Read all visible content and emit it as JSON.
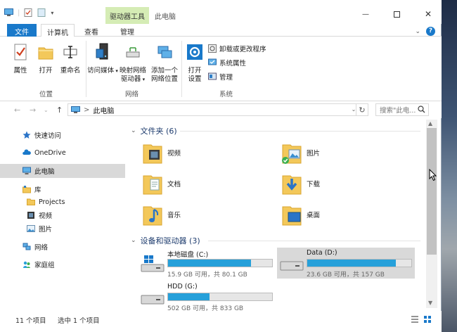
{
  "window": {
    "title": "此电脑",
    "context_tab": "驱动器工具",
    "tabs": {
      "file": "文件",
      "computer": "计算机",
      "view": "查看",
      "manage": "管理"
    }
  },
  "ribbon": {
    "location": {
      "label": "位置",
      "properties": "属性",
      "open": "打开",
      "rename": "重命名"
    },
    "network": {
      "label": "网络",
      "access_media": "访问媒体",
      "map_drive_1": "映射网络",
      "map_drive_2": "驱动器",
      "add_location_1": "添加一个",
      "add_location_2": "网络位置"
    },
    "system": {
      "label": "系统",
      "open_settings_1": "打开",
      "open_settings_2": "设置",
      "uninstall": "卸载或更改程序",
      "sys_properties": "系统属性",
      "manage": "管理"
    }
  },
  "address": {
    "path": "此电脑",
    "search_placeholder": "搜索\"此电...",
    "separator": ">"
  },
  "nav": {
    "quick_access": "快速访问",
    "onedrive": "OneDrive",
    "this_pc": "此电脑",
    "libraries": "库",
    "projects": "Projects",
    "videos": "视频",
    "pictures": "图片",
    "network": "网络",
    "homegroup": "家庭组"
  },
  "folders_section": {
    "title": "文件夹 (6)",
    "items": [
      "视频",
      "图片",
      "文档",
      "下载",
      "音乐",
      "桌面"
    ]
  },
  "drives_section": {
    "title": "设备和驱动器 (3)",
    "drives": [
      {
        "name": "本地磁盘 (C:)",
        "info": "15.9 GB 可用，共 80.1 GB",
        "used_fraction": 0.8
      },
      {
        "name": "Data (D:)",
        "info": "23.6 GB 可用，共 157 GB",
        "used_fraction": 0.85
      },
      {
        "name": "HDD (G:)",
        "info": "502 GB 可用，共 833 GB",
        "used_fraction": 0.4
      }
    ]
  },
  "status": {
    "count": "11 个项目",
    "selected": "选中 1 个项目"
  },
  "colors": {
    "accent": "#1979ca",
    "context_tab": "#d5ecb5",
    "drive_bar": "#26a0da",
    "folder": "#f3c85a"
  }
}
